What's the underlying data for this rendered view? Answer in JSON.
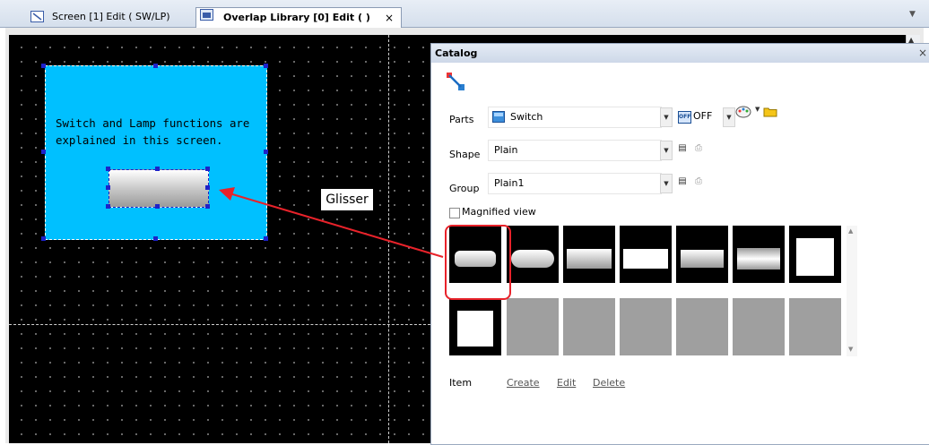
{
  "tabs": [
    {
      "label": "Screen [1] Edit (       SW/LP)",
      "active": false
    },
    {
      "label": "Overlap Library [0] Edit (          )",
      "active": true
    }
  ],
  "tab_close": "×",
  "tab_overflow": "▼",
  "overlay": {
    "text": "Switch and Lamp functions are\nexplained in this screen."
  },
  "annotation": {
    "label": "Glisser",
    "color": "#e8222a"
  },
  "catalog": {
    "title": "Catalog",
    "close": "×",
    "parts": {
      "label": "Parts",
      "value": "Switch",
      "off_label": "OFF"
    },
    "shape": {
      "label": "Shape",
      "value": "Plain"
    },
    "group": {
      "label": "Group",
      "value": "Plain1"
    },
    "magnified_view": {
      "label": "Magnified view",
      "checked": false
    },
    "item_label": "Item",
    "actions": {
      "create": "Create",
      "edit": "Edit",
      "delete": "Delete"
    },
    "selected_index": 0
  },
  "colors": {
    "overlay_bg": "#00c0ff",
    "canvas_bg": "#000000",
    "selection": "#1e22c8",
    "highlight": "#e8222a"
  }
}
